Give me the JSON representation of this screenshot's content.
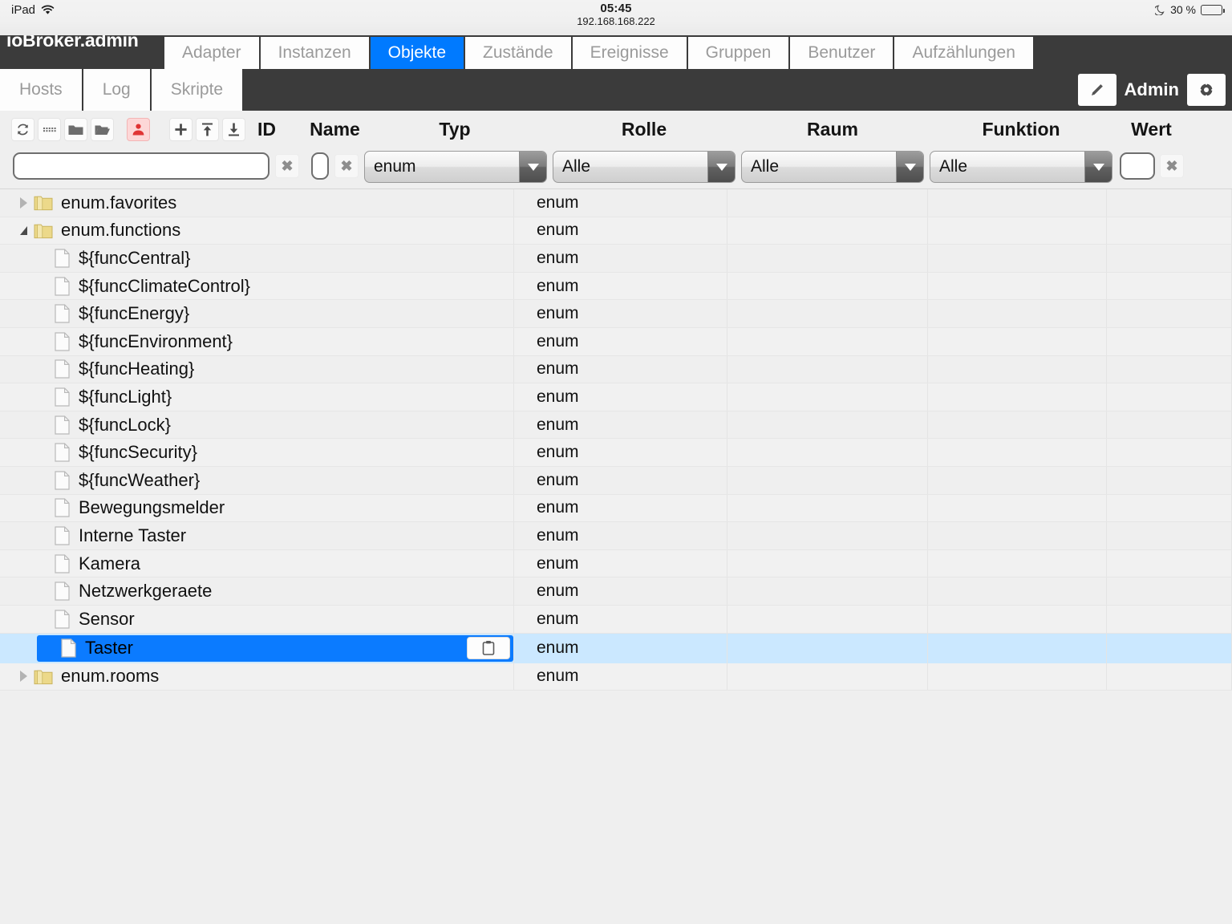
{
  "status_bar": {
    "device": "iPad",
    "wifi_icon": "wifi-icon",
    "clock": "05:45",
    "url": "192.168.168.222",
    "moon_icon": "moon-icon",
    "battery_text": "30 %",
    "battery_percent": 30
  },
  "header": {
    "brand": "ioBroker.admin",
    "tabs_row1": [
      {
        "label": "Adapter",
        "active": false
      },
      {
        "label": "Instanzen",
        "active": false
      },
      {
        "label": "Objekte",
        "active": true
      },
      {
        "label": "Zustände",
        "active": false
      },
      {
        "label": "Ereignisse",
        "active": false
      },
      {
        "label": "Gruppen",
        "active": false
      },
      {
        "label": "Benutzer",
        "active": false
      },
      {
        "label": "Aufzählungen",
        "active": false
      }
    ],
    "tabs_row2": [
      {
        "label": "Hosts"
      },
      {
        "label": "Log"
      },
      {
        "label": "Skripte"
      }
    ],
    "edit_icon": "pencil-icon",
    "user_label": "Admin",
    "settings_icon": "gear-icon",
    "active_tab_color": "#007aff",
    "bar_color": "#3b3b3b"
  },
  "toolbar": {
    "buttons": [
      {
        "name": "refresh-icon",
        "title": "Aktualisieren"
      },
      {
        "name": "columns-icon",
        "title": "Spalten"
      },
      {
        "name": "collapse-folder-icon",
        "title": "Alle schliessen"
      },
      {
        "name": "expand-folder-icon",
        "title": "Alle oeffnen"
      },
      {
        "name": "expert-mode-icon",
        "title": "Expertenmodus"
      },
      {
        "name": "add-icon",
        "title": "Hinzufuegen"
      },
      {
        "name": "import-icon",
        "title": "Importieren"
      },
      {
        "name": "export-icon",
        "title": "Exportieren"
      }
    ],
    "expert_active_color": "#fdd7d7"
  },
  "columns": [
    {
      "key": "id",
      "label": "ID"
    },
    {
      "key": "name",
      "label": "Name"
    },
    {
      "key": "typ",
      "label": "Typ"
    },
    {
      "key": "rolle",
      "label": "Rolle"
    },
    {
      "key": "raum",
      "label": "Raum"
    },
    {
      "key": "funktion",
      "label": "Funktion"
    },
    {
      "key": "wert",
      "label": "Wert"
    }
  ],
  "filters": {
    "id_value": "",
    "id_clear_label": "✖",
    "name_value": "",
    "name_clear_label": "✖",
    "typ_value": "enum",
    "rolle_value": "Alle",
    "raum_value": "Alle",
    "funktion_value": "Alle",
    "wert_value": "",
    "wert_clear_label": "✖"
  },
  "tree": {
    "rows": [
      {
        "label": "enum.favorites",
        "kind": "folder",
        "depth": 0,
        "twisty": "closed",
        "type": "enum",
        "selected": false
      },
      {
        "label": "enum.functions",
        "kind": "folder",
        "depth": 0,
        "twisty": "open",
        "type": "enum",
        "selected": false
      },
      {
        "label": "${funcCentral}",
        "kind": "file",
        "depth": 1,
        "twisty": "none",
        "type": "enum",
        "selected": false
      },
      {
        "label": "${funcClimateControl}",
        "kind": "file",
        "depth": 1,
        "twisty": "none",
        "type": "enum",
        "selected": false
      },
      {
        "label": "${funcEnergy}",
        "kind": "file",
        "depth": 1,
        "twisty": "none",
        "type": "enum",
        "selected": false
      },
      {
        "label": "${funcEnvironment}",
        "kind": "file",
        "depth": 1,
        "twisty": "none",
        "type": "enum",
        "selected": false
      },
      {
        "label": "${funcHeating}",
        "kind": "file",
        "depth": 1,
        "twisty": "none",
        "type": "enum",
        "selected": false
      },
      {
        "label": "${funcLight}",
        "kind": "file",
        "depth": 1,
        "twisty": "none",
        "type": "enum",
        "selected": false
      },
      {
        "label": "${funcLock}",
        "kind": "file",
        "depth": 1,
        "twisty": "none",
        "type": "enum",
        "selected": false
      },
      {
        "label": "${funcSecurity}",
        "kind": "file",
        "depth": 1,
        "twisty": "none",
        "type": "enum",
        "selected": false
      },
      {
        "label": "${funcWeather}",
        "kind": "file",
        "depth": 1,
        "twisty": "none",
        "type": "enum",
        "selected": false
      },
      {
        "label": "Bewegungsmelder",
        "kind": "file",
        "depth": 1,
        "twisty": "none",
        "type": "enum",
        "selected": false
      },
      {
        "label": "Interne Taster",
        "kind": "file",
        "depth": 1,
        "twisty": "none",
        "type": "enum",
        "selected": false
      },
      {
        "label": "Kamera",
        "kind": "file",
        "depth": 1,
        "twisty": "none",
        "type": "enum",
        "selected": false
      },
      {
        "label": "Netzwerkgeraete",
        "kind": "file",
        "depth": 1,
        "twisty": "none",
        "type": "enum",
        "selected": false
      },
      {
        "label": "Sensor",
        "kind": "file",
        "depth": 1,
        "twisty": "none",
        "type": "enum",
        "selected": false
      },
      {
        "label": "Taster",
        "kind": "file",
        "depth": 1,
        "twisty": "none",
        "type": "enum",
        "selected": true,
        "action_icon": "clipboard-icon"
      },
      {
        "label": "enum.rooms",
        "kind": "folder",
        "depth": 0,
        "twisty": "closed",
        "type": "enum",
        "selected": false
      }
    ],
    "selection_color": "#0b7bff",
    "selection_row_color": "#cbe8ff"
  }
}
